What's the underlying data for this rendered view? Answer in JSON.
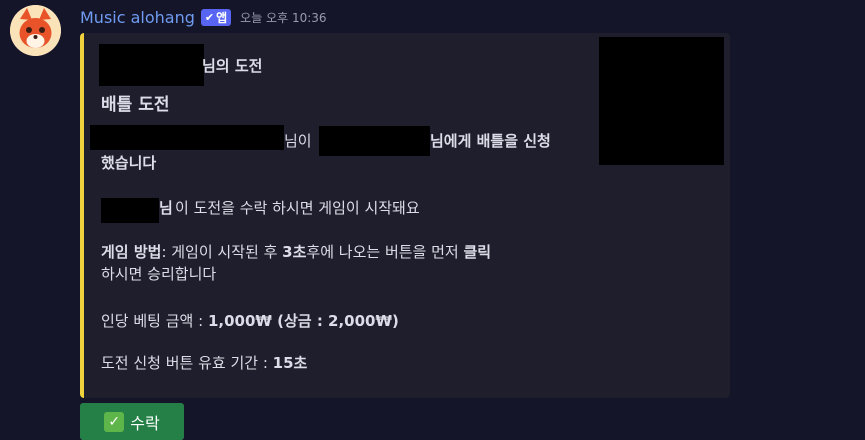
{
  "message": {
    "author": "Music alohang",
    "app_badge": "앱",
    "timestamp": "오늘 오후 10:36"
  },
  "embed": {
    "accent_color": "#f0d33c",
    "author_suffix": "님의 도전",
    "title": "배틀 도전",
    "line1_a": "님이",
    "line1_b": "님에게 배틀을 신청",
    "line1_c": "했습니다",
    "line2_a": "님",
    "line2_b": "이 도전을 수락 하시면 게임이 시작돼요",
    "rules_label": "게임 방법",
    "rules_a": ": 게임이 시작된 후 ",
    "rules_b": "3초",
    "rules_c": "후에 나오는 버튼을 먼저 ",
    "rules_d": "클릭",
    "rules_e": "하시면 승리합니다",
    "bet_label": "인당 베팅 금액 : ",
    "bet_value": "1,000₩ (상금 : 2,000₩)",
    "timeout_label": "도전 신청 버튼 유효 기간 : ",
    "timeout_value": "15초"
  },
  "button": {
    "label": "수락",
    "icon": "check-mark-emoji",
    "color": "#248046"
  }
}
